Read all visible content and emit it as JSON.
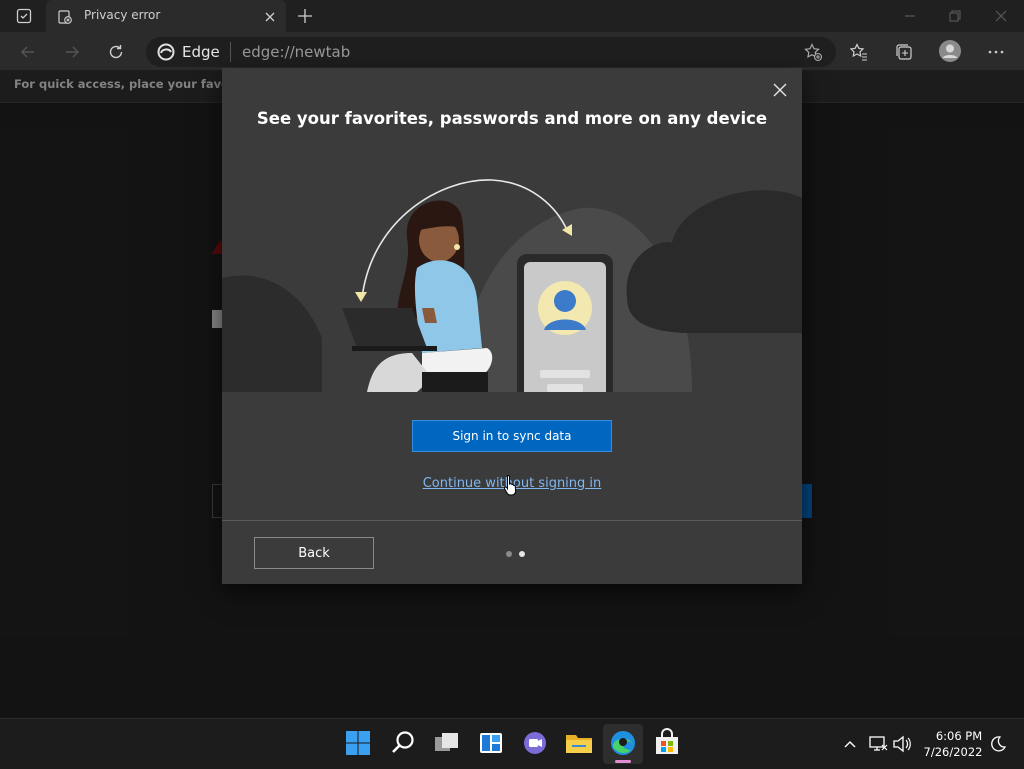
{
  "browser": {
    "tab_title": "Privacy error",
    "address_brand": "Edge",
    "address_url": "edge://newtab",
    "favorites_bar_text": "For quick access, place your favorites h"
  },
  "dialog": {
    "title": "See your favorites, passwords and more on any device",
    "signin_label": "Sign in to sync data",
    "continue_label": "Continue without signing in",
    "back_label": "Back",
    "page_dots": 2,
    "active_dot": 2
  },
  "taskbar": {
    "time": "6:06 PM",
    "date": "7/26/2022",
    "icons": [
      "windows-start-icon",
      "search-icon",
      "task-view-icon",
      "widgets-icon",
      "chat-icon",
      "file-explorer-icon",
      "edge-icon",
      "store-icon"
    ]
  },
  "colors": {
    "accent": "#0067c0",
    "link": "#7fb7f0",
    "dialog_bg": "#3b3b3b"
  }
}
